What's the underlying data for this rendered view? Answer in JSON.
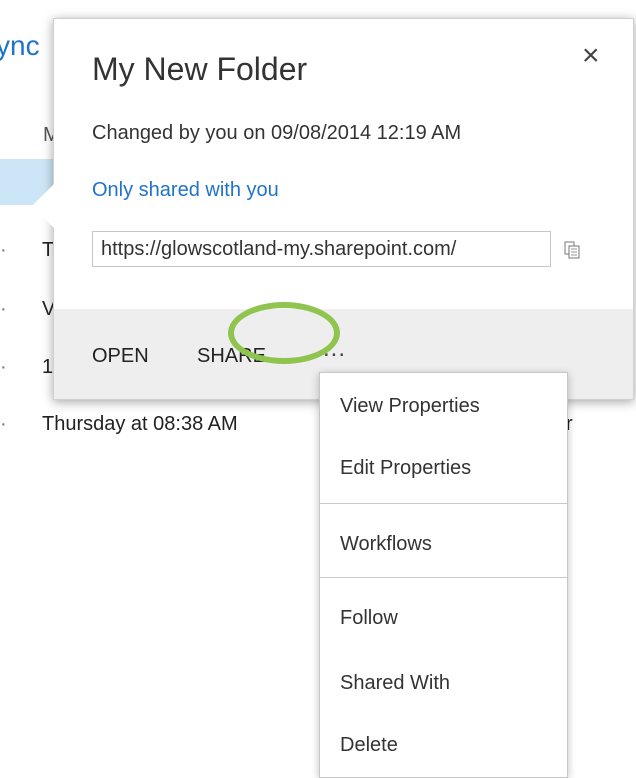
{
  "background": {
    "title_fragment": "ync",
    "label_fragment": "M",
    "rows": [
      "T",
      "V",
      "1",
      "Thursday at 08:38 AM"
    ],
    "trailing_fragment": "r"
  },
  "callout": {
    "title": "My New Folder",
    "close_icon": "×",
    "changed_text": "Changed by you on 09/08/2014 12:19 AM",
    "sharing_link": "Only shared with you",
    "url_value": "https://glowscotland-my.sharepoint.com/",
    "copy_icon": "copy-to-clipboard-icon",
    "footer": {
      "open_label": "OPEN",
      "share_label": "SHARE",
      "more_label": "..."
    }
  },
  "menu": {
    "items": [
      "View Properties",
      "Edit Properties",
      "Workflows",
      "Follow",
      "Shared With",
      "Delete"
    ]
  },
  "colors": {
    "link_blue": "#1f73c9",
    "highlight_green": "#8fc44f",
    "footer_gray": "#eeeeee"
  }
}
